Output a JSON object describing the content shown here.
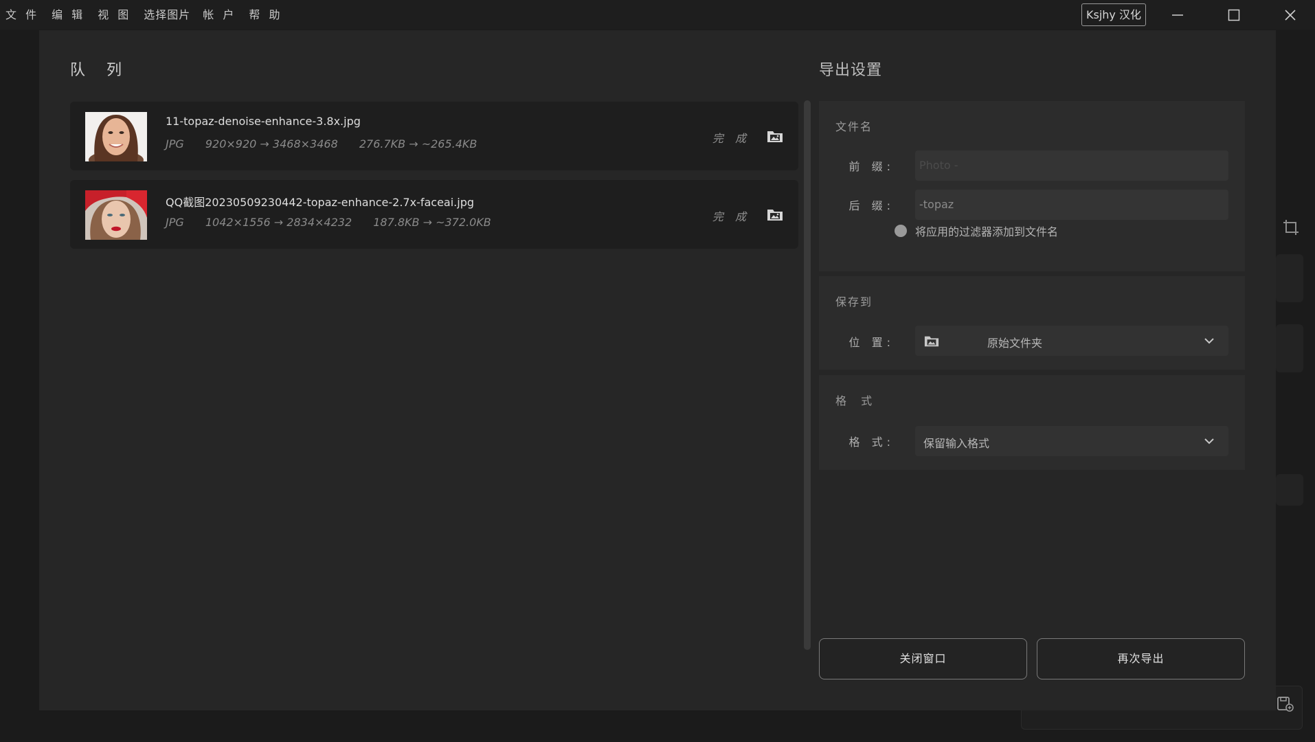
{
  "menu": [
    "文 件",
    "编 辑",
    "视 图",
    "选择图片",
    "帐 户",
    "帮 助"
  ],
  "badge": "Ksjhy 汉化",
  "queue": {
    "title": "队 列",
    "items": [
      {
        "name": "11-topaz-denoise-enhance-3.8x.jpg",
        "format": "JPG",
        "dimensions": "920×920 → 3468×3468",
        "size": "276.7KB → ~265.4KB",
        "status": "完 成"
      },
      {
        "name": "QQ截图20230509230442-topaz-enhance-2.7x-faceai.jpg",
        "format": "JPG",
        "dimensions": "1042×1556 → 2834×4232",
        "size": "187.8KB → ~372.0KB",
        "status": "完 成"
      }
    ]
  },
  "export": {
    "title": "导出设置",
    "filename": {
      "title": "文件名",
      "prefix_label": "前 缀:",
      "prefix_value": "Photo -",
      "suffix_label": "后 缀:",
      "suffix_value": "-topaz",
      "filter_toggle_label": "将应用的过滤器添加到文件名"
    },
    "save_to": {
      "title": "保存到",
      "location_label": "位 置:",
      "location_value": "原始文件夹"
    },
    "format": {
      "title": "格 式",
      "format_label": "格 式:",
      "format_value": "保留输入格式"
    },
    "close_button": "关闭窗口",
    "export_again_button": "再次导出"
  },
  "colors": {
    "dialog_bg": "#262626",
    "item_bg": "#1e1e1e",
    "panel_bg": "#2c2c2c"
  }
}
